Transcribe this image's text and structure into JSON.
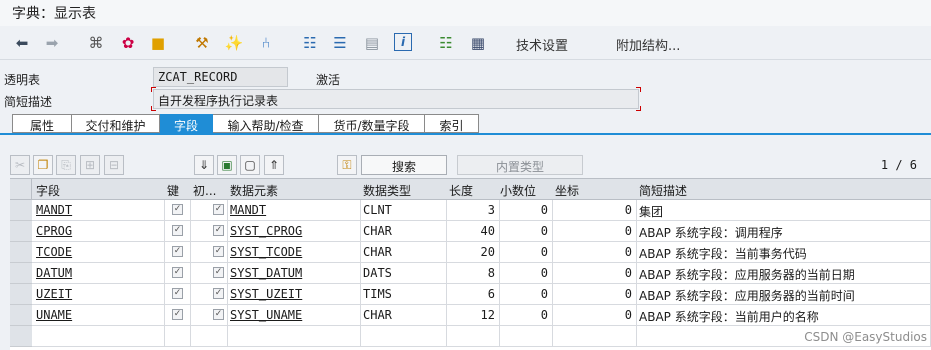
{
  "window": {
    "title": "字典：显示表"
  },
  "toolbar": {
    "icons": [
      "back-icon",
      "forward-icon",
      "glasses-icon",
      "colors-icon",
      "activate-icon",
      "where-used-icon",
      "magic-wand-icon",
      "branch-icon",
      "hierarchy-icon",
      "stack-icon",
      "frame-icon",
      "info-icon",
      "grid-icon",
      "table-icon"
    ],
    "tech_settings": "技术设置",
    "append_structure": "附加结构..."
  },
  "header": {
    "table_label": "透明表",
    "table_name": "ZCAT_RECORD",
    "status": "激活",
    "desc_label": "简短描述",
    "description": "自开发程序执行记录表"
  },
  "tabs": [
    {
      "label": "属性"
    },
    {
      "label": "交付和维护"
    },
    {
      "label": "字段"
    },
    {
      "label": "输入帮助/检查"
    },
    {
      "label": "货币/数量字段"
    },
    {
      "label": "索引"
    }
  ],
  "table_toolbar": {
    "search_button": "搜索",
    "builtin_type_button": "内置类型",
    "pager": "1 / 6"
  },
  "columns": [
    "字段",
    "键",
    "初...",
    "数据元素",
    "数据类型",
    "长度",
    "小数位",
    "坐标",
    "简短描述"
  ],
  "rows": [
    {
      "field": "MANDT",
      "key": "✓",
      "init": "✓",
      "element": "MANDT",
      "type": "CLNT",
      "length": "3",
      "decimals": "0",
      "coord": "0",
      "desc": "集团"
    },
    {
      "field": "CPROG",
      "key": "✓",
      "init": "✓",
      "element": "SYST_CPROG",
      "type": "CHAR",
      "length": "40",
      "decimals": "0",
      "coord": "0",
      "desc": "ABAP 系统字段：调用程序"
    },
    {
      "field": "TCODE",
      "key": "✓",
      "init": "✓",
      "element": "SYST_TCODE",
      "type": "CHAR",
      "length": "20",
      "decimals": "0",
      "coord": "0",
      "desc": "ABAP 系统字段：当前事务代码"
    },
    {
      "field": "DATUM",
      "key": "✓",
      "init": "✓",
      "element": "SYST_DATUM",
      "type": "DATS",
      "length": "8",
      "decimals": "0",
      "coord": "0",
      "desc": "ABAP 系统字段：应用服务器的当前日期"
    },
    {
      "field": "UZEIT",
      "key": "✓",
      "init": "✓",
      "element": "SYST_UZEIT",
      "type": "TIMS",
      "length": "6",
      "decimals": "0",
      "coord": "0",
      "desc": "ABAP 系统字段：应用服务器的当前时间"
    },
    {
      "field": "UNAME",
      "key": "✓",
      "init": "✓",
      "element": "SYST_UNAME",
      "type": "CHAR",
      "length": "12",
      "decimals": "0",
      "coord": "0",
      "desc": "ABAP 系统字段：当前用户的名称"
    }
  ],
  "watermark": "CSDN @EasyStudios"
}
